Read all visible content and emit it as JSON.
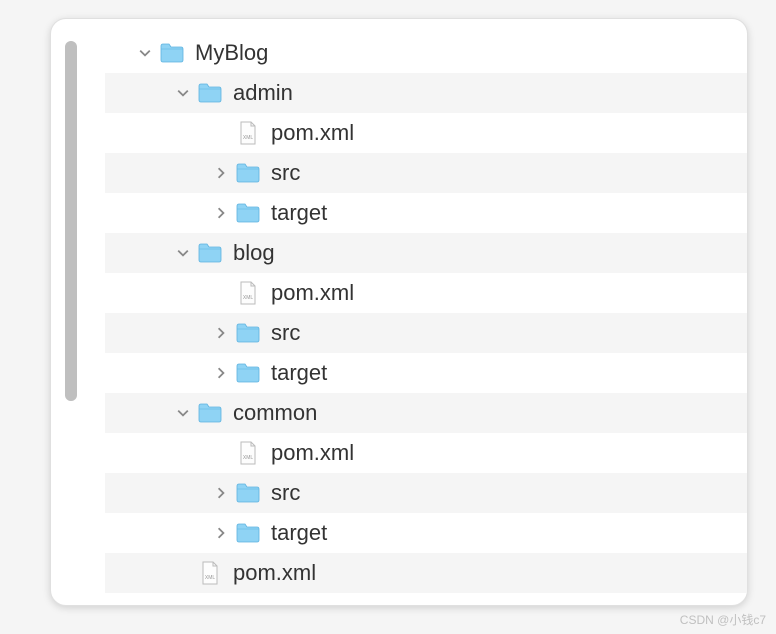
{
  "tree": {
    "root": {
      "label": "MyBlog",
      "children": {
        "admin": {
          "label": "admin",
          "pom": "pom.xml",
          "src": "src",
          "target": "target"
        },
        "blog": {
          "label": "blog",
          "pom": "pom.xml",
          "src": "src",
          "target": "target"
        },
        "common": {
          "label": "common",
          "pom": "pom.xml",
          "src": "src",
          "target": "target"
        },
        "pom": "pom.xml"
      }
    }
  },
  "icons": {
    "folder": "folder-icon",
    "xml_file": "xml-file-icon",
    "chevron_down": "▾",
    "chevron_right": "▸"
  },
  "watermark": "CSDN @小钱c7"
}
